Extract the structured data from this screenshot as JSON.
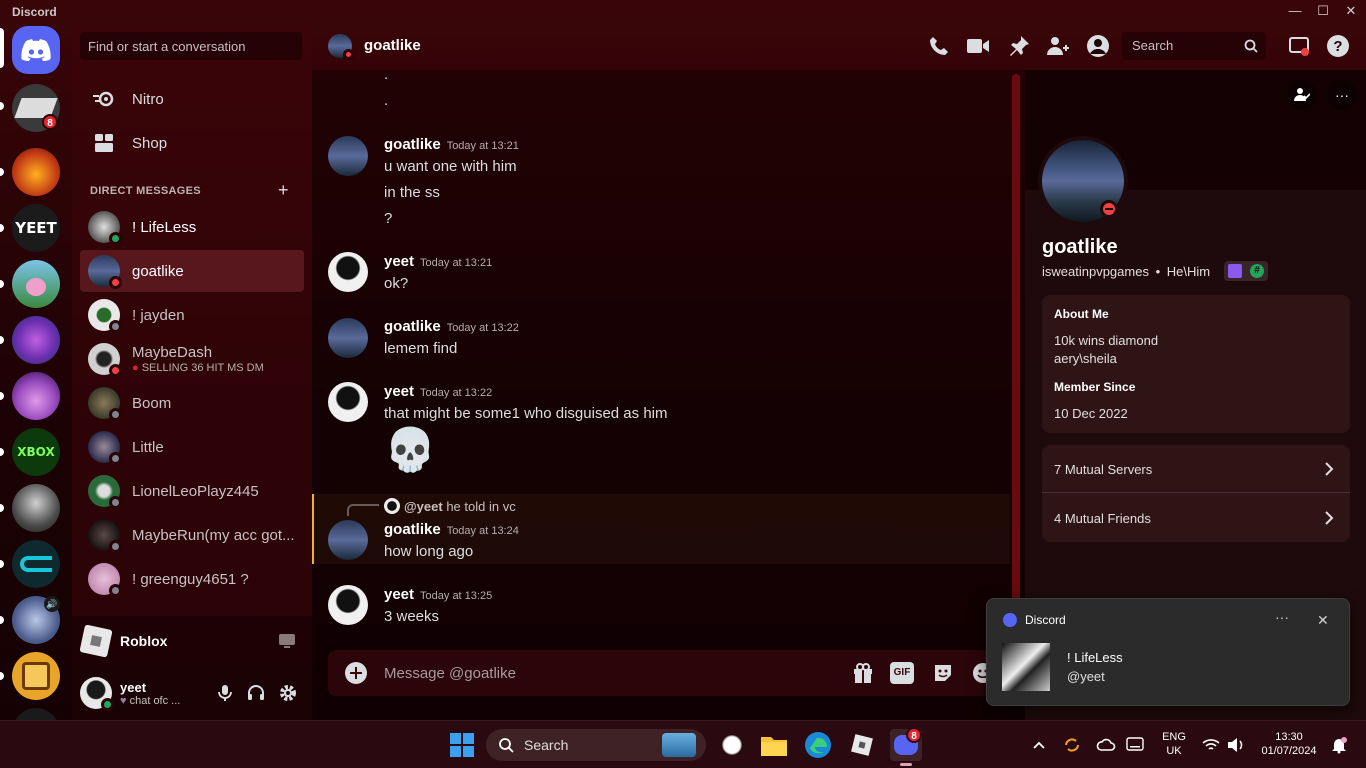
{
  "window": {
    "title": "Discord",
    "controls": {
      "minimize": "—",
      "maximize": "☐",
      "close": "✕"
    }
  },
  "servers": {
    "home_icon": "discord-logo-icon",
    "home_badge": "8",
    "items": [
      {
        "name": "server-1",
        "badge": "8",
        "color": "#3a3a3a"
      },
      {
        "name": "server-2",
        "color": "#c23a14"
      },
      {
        "name": "server-3-yeet",
        "text": "YEET",
        "color": "#1b1b1b"
      },
      {
        "name": "server-4",
        "color": "#3b8a3e"
      },
      {
        "name": "server-5",
        "color": "#6b2fb0"
      },
      {
        "name": "server-6",
        "color": "#9a4cc0"
      },
      {
        "name": "server-7-xbox",
        "text": "XBOX",
        "color": "#0c7a0c"
      },
      {
        "name": "server-8",
        "color": "#8c8c8c"
      },
      {
        "name": "server-9",
        "color": "#0c3a3a"
      },
      {
        "name": "server-10",
        "color": "#4a5a8a"
      },
      {
        "name": "server-11",
        "color": "#e8a52a"
      }
    ]
  },
  "sidebar": {
    "search_placeholder": "Find or start a conversation",
    "nav": [
      {
        "label": "Nitro",
        "icon": "nitro-icon"
      },
      {
        "label": "Shop",
        "icon": "shop-icon"
      }
    ],
    "dm_header": "DIRECT MESSAGES",
    "dm_add": "+",
    "dms": [
      {
        "name": "! LifeLess",
        "status": "online",
        "color": "#7a7a7a"
      },
      {
        "name": "goatlike",
        "status": "dnd",
        "active": true,
        "color": "#3b4f78"
      },
      {
        "name": "! jayden",
        "status": "offline",
        "color": "#d8d8d8"
      },
      {
        "name": "MaybeDash",
        "status": "dnd",
        "sub": "SELLING 36 HIT MS DM",
        "color": "#bcbcbc"
      },
      {
        "name": "Boom",
        "status": "offline",
        "color": "#6a5a3a"
      },
      {
        "name": "Little",
        "status": "offline",
        "color": "#3a3a5a"
      },
      {
        "name": "LionelLeoPlayz445",
        "status": "offline",
        "color": "#2a6a3a"
      },
      {
        "name": "MaybeRun(my acc got...",
        "status": "offline",
        "color": "#3a2a2a"
      },
      {
        "name": "! greenguy4651 ?",
        "status": "offline",
        "color": "#c08ab0"
      }
    ],
    "activity": {
      "label": "Roblox"
    },
    "user": {
      "name": "yeet",
      "status_text": "chat ofc ..."
    }
  },
  "chat": {
    "channel_name": "goatlike",
    "toolbar_search": "Search",
    "messages": [
      {
        "author": "goatlike",
        "time": "Today at 13:21",
        "lines": [
          "u want one with him",
          "in the ss",
          "?"
        ]
      },
      {
        "author": "yeet",
        "time": "Today at 13:21",
        "lines": [
          "ok?"
        ]
      },
      {
        "author": "goatlike",
        "time": "Today at 13:22",
        "lines": [
          "lemem find"
        ]
      },
      {
        "author": "yeet",
        "time": "Today at 13:22",
        "lines": [
          "that might be some1 who disguised as him"
        ],
        "emoji": "💀"
      },
      {
        "author": "goatlike",
        "time": "Today at 13:24",
        "lines": [
          "how long ago"
        ],
        "reply_to": "@yeet",
        "reply_text": "he told in vc"
      },
      {
        "author": "yeet",
        "time": "Today at 13:25",
        "lines": [
          "3 weeks"
        ]
      }
    ],
    "top_dots": [
      ".",
      "."
    ],
    "composer_placeholder": "Message @goatlike",
    "composer_gif": "GIF"
  },
  "profile": {
    "name": "goatlike",
    "username": "isweatinpvpgames",
    "pronouns": "He\\Him",
    "separator": "•",
    "about_label": "About Me",
    "about_lines": [
      "10k wins diamond",
      "aery\\sheila"
    ],
    "member_since_label": "Member Since",
    "member_since": "10 Dec 2022",
    "mutual_servers": "7 Mutual Servers",
    "mutual_friends": "4 Mutual Friends",
    "badge_hash": "#"
  },
  "toast": {
    "app": "Discord",
    "title": "! LifeLess",
    "body": "@yeet",
    "more": "···",
    "close": "✕"
  },
  "taskbar": {
    "search_label": "Search",
    "lang_top": "ENG",
    "lang_bottom": "UK",
    "time": "13:30",
    "date": "01/07/2024",
    "discord_badge": "8"
  },
  "colors": {
    "accent": "#5865f2",
    "online": "#23a55a",
    "dnd": "#f23f43",
    "offline": "#80848e"
  }
}
